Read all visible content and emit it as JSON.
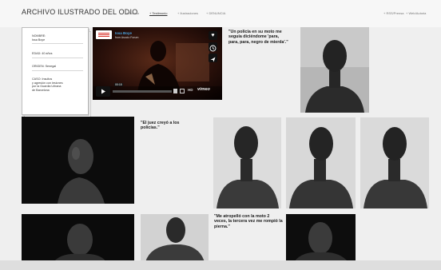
{
  "header": {
    "site_title": "ARCHIVO ILUSTRADO DEL ODIO",
    "nav": [
      "+ Autoria",
      "+ Testimonio",
      "+ Ilustraciones",
      "+ DENUNCIA"
    ],
    "nav_right": [
      "+ RSS/Prensa",
      "+ Web/Autoria"
    ]
  },
  "profile": {
    "name_label": "NOMBRE:",
    "name_value": "Issa Boye",
    "age": "EDAD: 40 años",
    "origin": "ORIGEN: Senegal",
    "case_lines": [
      "CASO: Insultos",
      "y agresión con lesiones",
      "por la Guardia Urbana",
      "de Barcelona"
    ]
  },
  "video": {
    "title": "Issa Boye",
    "subtitle": "from Asocio Forum",
    "time": "00:15",
    "hd": "HD",
    "vimeo": "vimeo"
  },
  "quotes": [
    "\"Un policía en su moto me seguía diciéndome 'para, para, para, negro de mierda'.\"",
    "\"El juez creyó a los policías.\"",
    "\"Me atropelló con la moto 2 veces, la tercera vez me rompió la pierna.\""
  ],
  "colors": {
    "accent": "#d9332b",
    "page_bg": "#efefef",
    "video_bg": "#1a0a07"
  }
}
